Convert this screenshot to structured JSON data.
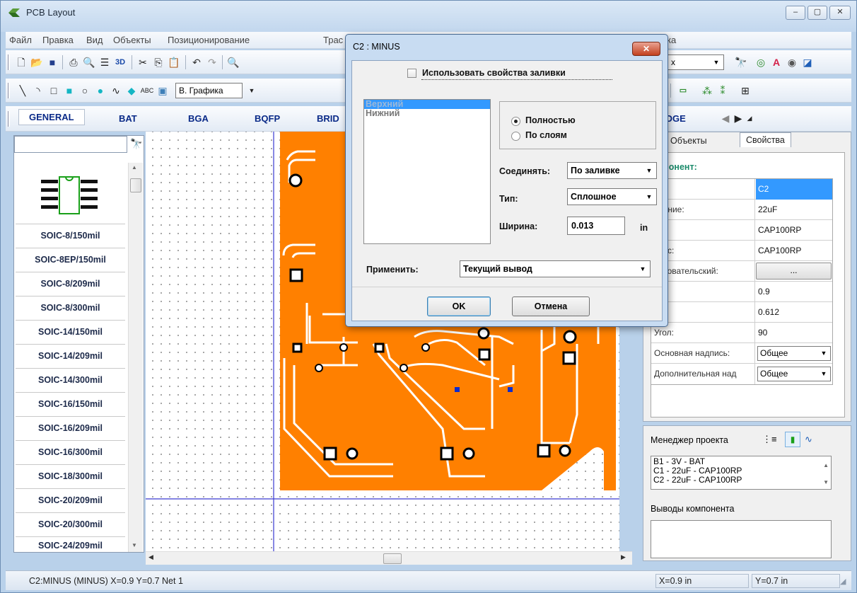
{
  "window": {
    "title": "PCB Layout",
    "controls": [
      "–",
      "▢",
      "✕"
    ]
  },
  "menu": [
    "Файл",
    "Правка",
    "Вид",
    "Объекты",
    "Позиционирование",
    "Трас",
    "ка"
  ],
  "toolbar": {
    "layer_combo": "В. Графика",
    "right_combo": "x"
  },
  "library": {
    "tabs": [
      "GENERAL",
      "BAT",
      "BGA",
      "BQFP",
      "BRID",
      "EDGE"
    ],
    "items": [
      "SOIC-8/150mil",
      "SOIC-8EP/150mil",
      "SOIC-8/209mil",
      "SOIC-8/300mil",
      "SOIC-14/150mil",
      "SOIC-14/209mil",
      "SOIC-14/300mil",
      "SOIC-16/150mil",
      "SOIC-16/209mil",
      "SOIC-16/300mil",
      "SOIC-18/300mil",
      "SOIC-20/209mil",
      "SOIC-20/300mil",
      "SOIC-24/209mil"
    ]
  },
  "right_panel": {
    "tabs": [
      "и",
      "Объекты",
      "Свойства"
    ],
    "section_title": "мпонент:",
    "properties": [
      {
        "name": "тка:",
        "value": "C2"
      },
      {
        "name": "ачение:",
        "value": "22uF"
      },
      {
        "name": "п:",
        "value": "CAP100RP"
      },
      {
        "name": "опус:",
        "value": "CAP100RP"
      },
      {
        "name": "льзовательский:",
        "value": "..."
      },
      {
        "name": "",
        "value": "0.9"
      },
      {
        "name": "",
        "value": "0.612"
      },
      {
        "name": "Угол:",
        "value": "90"
      },
      {
        "name": "Основная надпись:",
        "value": "Общее"
      },
      {
        "name": "Дополнительная над",
        "value": "Общее"
      }
    ]
  },
  "project_manager": {
    "title": "Менеджер проекта",
    "items": [
      "B1 - 3V - BAT",
      "C1 - 22uF - CAP100RP",
      "C2 - 22uF - CAP100RP"
    ],
    "pins_title": "Выводы компонента"
  },
  "status": {
    "main": "C2:MINUS (MINUS)  X=0.9  Y=0.7   Net 1",
    "x": "X=0.9 in",
    "y": "Y=0.7 in"
  },
  "dialog": {
    "title": "C2 : MINUS",
    "use_fill_label": "Использовать свойства заливки",
    "layers": [
      "Верхний",
      "Нижний"
    ],
    "radio_full": "Полностью",
    "radio_layers": "По слоям",
    "connect_label": "Соединять:",
    "connect_value": "По заливке",
    "type_label": "Тип:",
    "type_value": "Сплошное",
    "width_label": "Ширина:",
    "width_value": "0.013",
    "width_unit": "in",
    "apply_label": "Применить:",
    "apply_value": "Текущий вывод",
    "ok": "OK",
    "cancel": "Отмена",
    "close": "✕"
  },
  "colors": {
    "copper": "#ff8000",
    "selection": "#3399ff",
    "grid_line": "#3a3ad0"
  }
}
